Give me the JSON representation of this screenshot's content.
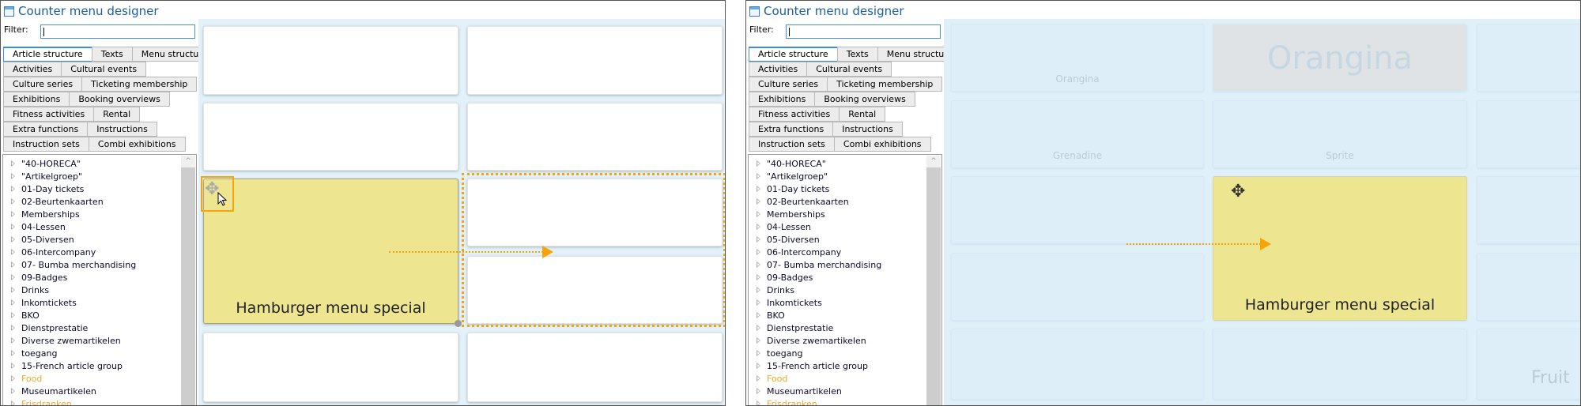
{
  "window_title": "Counter menu designer",
  "filter": {
    "label": "Filter:",
    "value": ""
  },
  "tab_rows": [
    [
      "Article structure",
      "Texts",
      "Menu structure"
    ],
    [
      "Activities",
      "Cultural events"
    ],
    [
      "Culture series",
      "Ticketing membership"
    ],
    [
      "Exhibitions",
      "Booking overviews"
    ],
    [
      "Fitness activities",
      "Rental"
    ],
    [
      "Extra functions",
      "Instructions"
    ],
    [
      "Instruction sets",
      "Combi exhibitions"
    ]
  ],
  "active_tab": "Article structure",
  "tree_items": [
    {
      "label": "\"40-HORECA\""
    },
    {
      "label": "\"Artikelgroep\""
    },
    {
      "label": "01-Day tickets"
    },
    {
      "label": "02-Beurtenkaarten"
    },
    {
      "label": "Memberships"
    },
    {
      "label": "04-Lessen"
    },
    {
      "label": "05-Diversen"
    },
    {
      "label": "06-Intercompany"
    },
    {
      "label": "07- Bumba merchandising"
    },
    {
      "label": "09-Badges"
    },
    {
      "label": "Drinks"
    },
    {
      "label": "Inkomtickets"
    },
    {
      "label": "BKO"
    },
    {
      "label": "Dienstprestatie"
    },
    {
      "label": "Diverse zwemartikelen"
    },
    {
      "label": "toegang"
    },
    {
      "label": "15-French article group"
    },
    {
      "label": "Food",
      "highlight": true
    },
    {
      "label": "Museumartikelen"
    },
    {
      "label": "Frisdranken",
      "highlight": true
    }
  ],
  "highlight_color": "#f5a623",
  "accent_color": "#f5a50a",
  "tile_yellow": "#ede58f",
  "left_panel": {
    "dragged_tile": "Hamburger menu special"
  },
  "right_panel": {
    "tiles": {
      "r1c1": "Orangina",
      "r1c2": "Orangina",
      "r2c1": "Grenadine",
      "r2c2": "Sprite",
      "r5c3": "Fruit"
    },
    "dragged_tile": "Hamburger menu special"
  }
}
